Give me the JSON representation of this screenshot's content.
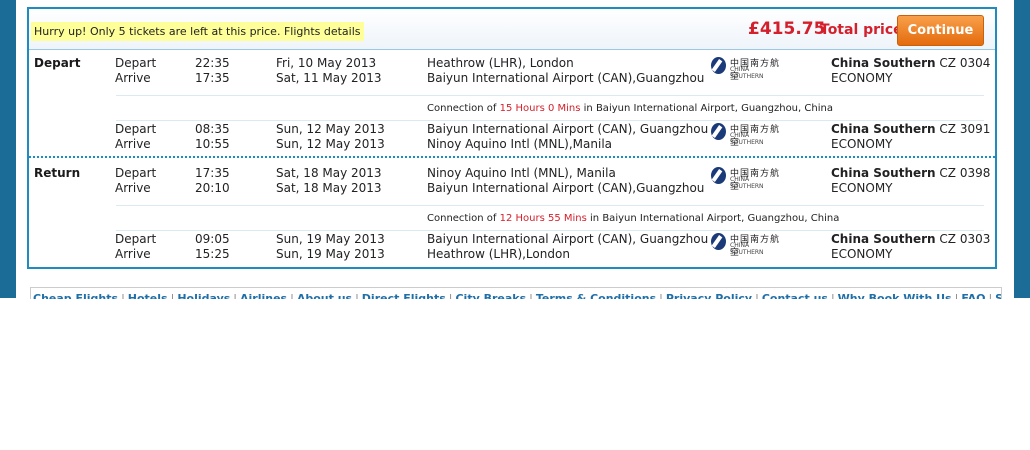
{
  "header": {
    "hurry_text": "Hurry up! Only 5 tickets are left at this price. Flights details",
    "price": "£415.75",
    "price_label": "Total price",
    "continue_label": "Continue"
  },
  "outbound": {
    "label": "Depart",
    "leg1": {
      "depart_label": "Depart",
      "depart_time": "22:35",
      "depart_date": "Fri, 10 May 2013",
      "depart_airport": "Heathrow (LHR), London",
      "arrive_label": "Arrive",
      "arrive_time": "17:35",
      "arrive_date": "Sat, 11 May 2013",
      "arrive_airport": "Baiyun International Airport (CAN),Guangzhou",
      "airline": "China Southern",
      "flight": "CZ 0304",
      "cabin": "ECONOMY"
    },
    "connection": {
      "prefix": "Connection of",
      "duration": "15 Hours 0 Mins",
      "suffix": "in Baiyun International Airport, Guangzhou, China"
    },
    "leg2": {
      "depart_label": "Depart",
      "depart_time": "08:35",
      "depart_date": "Sun, 12 May 2013",
      "depart_airport": "Baiyun International Airport (CAN), Guangzhou",
      "arrive_label": "Arrive",
      "arrive_time": "10:55",
      "arrive_date": "Sun, 12 May 2013",
      "arrive_airport": "Ninoy Aquino Intl (MNL),Manila",
      "airline": "China Southern",
      "flight": "CZ 3091",
      "cabin": "ECONOMY"
    }
  },
  "return": {
    "label": "Return",
    "leg1": {
      "depart_label": "Depart",
      "depart_time": "17:35",
      "depart_date": "Sat, 18 May 2013",
      "depart_airport": "Ninoy Aquino Intl (MNL), Manila",
      "arrive_label": "Arrive",
      "arrive_time": "20:10",
      "arrive_date": "Sat, 18 May 2013",
      "arrive_airport": "Baiyun International Airport (CAN),Guangzhou",
      "airline": "China Southern",
      "flight": "CZ 0398",
      "cabin": "ECONOMY"
    },
    "connection": {
      "prefix": "Connection of",
      "duration": "12 Hours 55 Mins",
      "suffix": "in Baiyun International Airport, Guangzhou, China"
    },
    "leg2": {
      "depart_label": "Depart",
      "depart_time": "09:05",
      "depart_date": "Sun, 19 May 2013",
      "depart_airport": "Baiyun International Airport (CAN), Guangzhou",
      "arrive_label": "Arrive",
      "arrive_time": "15:25",
      "arrive_date": "Sun, 19 May 2013",
      "arrive_airport": "Heathrow (LHR),London",
      "airline": "China Southern",
      "flight": "CZ 0303",
      "cabin": "ECONOMY"
    }
  },
  "airline_logo": {
    "icon": "china-southern-logo",
    "cn_text": "中国南方航空",
    "en_text": "CHINA SOUTHERN"
  },
  "footer": {
    "links": [
      "Cheap Flights",
      "Hotels",
      "Holidays",
      "Airlines",
      "About us",
      "Direct Flights",
      "City Breaks",
      "Terms & Conditions",
      "Privacy Policy",
      "Contact us",
      "Why Book With Us",
      "FAQ",
      "Site Map"
    ]
  },
  "colors": {
    "accent": "#1f8bbf",
    "price": "#d4202c",
    "button": "#e46b0e",
    "band": "#1b6d98"
  }
}
